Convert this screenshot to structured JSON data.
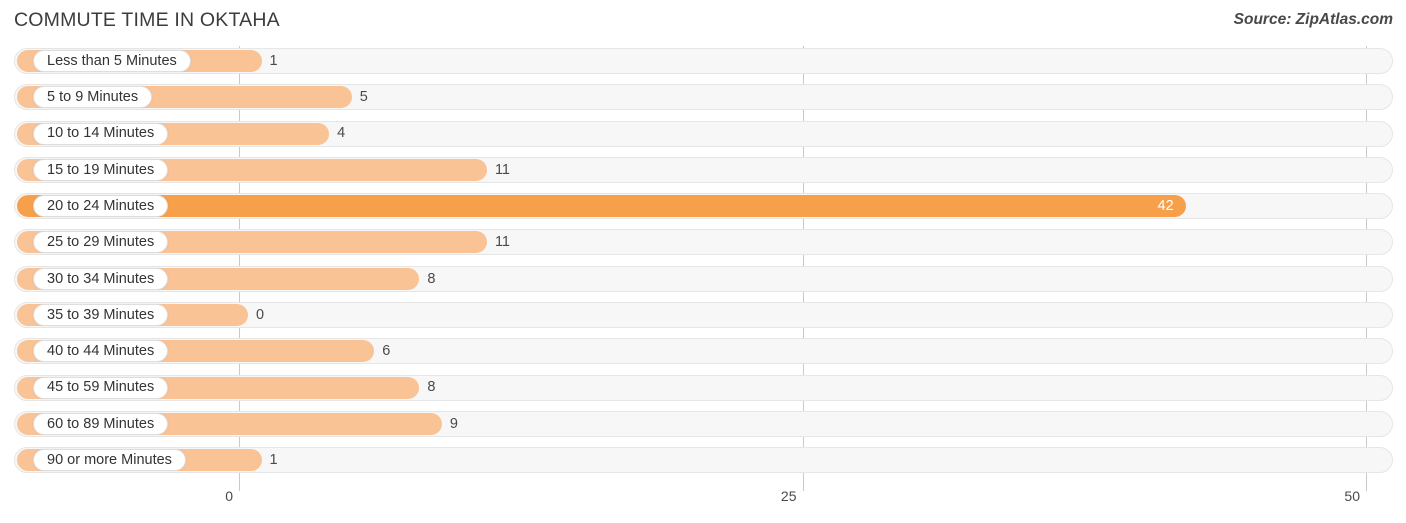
{
  "header": {
    "title": "COMMUTE TIME IN OKTAHA",
    "source": "Source: ZipAtlas.com"
  },
  "colors": {
    "bar": "#f9c396",
    "bar_highlight": "#f7a04c",
    "track": "#f7f7f7",
    "gridline": "#c9c9c9",
    "text": "#3a3a3a"
  },
  "axis": {
    "ticks": [
      "0",
      "25",
      "50"
    ],
    "min": 0,
    "max": 50
  },
  "chart_data": {
    "type": "bar",
    "orientation": "horizontal",
    "title": "COMMUTE TIME IN OKTAHA",
    "xlabel": "",
    "ylabel": "",
    "xlim": [
      0,
      50
    ],
    "grid": true,
    "legend": null,
    "source": "Source: ZipAtlas.com",
    "categories": [
      "Less than 5 Minutes",
      "5 to 9 Minutes",
      "10 to 14 Minutes",
      "15 to 19 Minutes",
      "20 to 24 Minutes",
      "25 to 29 Minutes",
      "30 to 34 Minutes",
      "35 to 39 Minutes",
      "40 to 44 Minutes",
      "45 to 59 Minutes",
      "60 to 89 Minutes",
      "90 or more Minutes"
    ],
    "values": [
      1,
      5,
      4,
      11,
      42,
      11,
      8,
      0,
      6,
      8,
      9,
      1
    ],
    "highlight_index": 4,
    "tick_values": [
      0,
      25,
      50
    ]
  },
  "rows": [
    {
      "label": "Less than 5 Minutes",
      "value": "1",
      "n": 1
    },
    {
      "label": "5 to 9 Minutes",
      "value": "5",
      "n": 5
    },
    {
      "label": "10 to 14 Minutes",
      "value": "4",
      "n": 4
    },
    {
      "label": "15 to 19 Minutes",
      "value": "11",
      "n": 11
    },
    {
      "label": "20 to 24 Minutes",
      "value": "42",
      "n": 42
    },
    {
      "label": "25 to 29 Minutes",
      "value": "11",
      "n": 11
    },
    {
      "label": "30 to 34 Minutes",
      "value": "8",
      "n": 8
    },
    {
      "label": "35 to 39 Minutes",
      "value": "0",
      "n": 0
    },
    {
      "label": "40 to 44 Minutes",
      "value": "6",
      "n": 6
    },
    {
      "label": "45 to 59 Minutes",
      "value": "8",
      "n": 8
    },
    {
      "label": "60 to 89 Minutes",
      "value": "9",
      "n": 9
    },
    {
      "label": "90 or more Minutes",
      "value": "1",
      "n": 1
    }
  ]
}
